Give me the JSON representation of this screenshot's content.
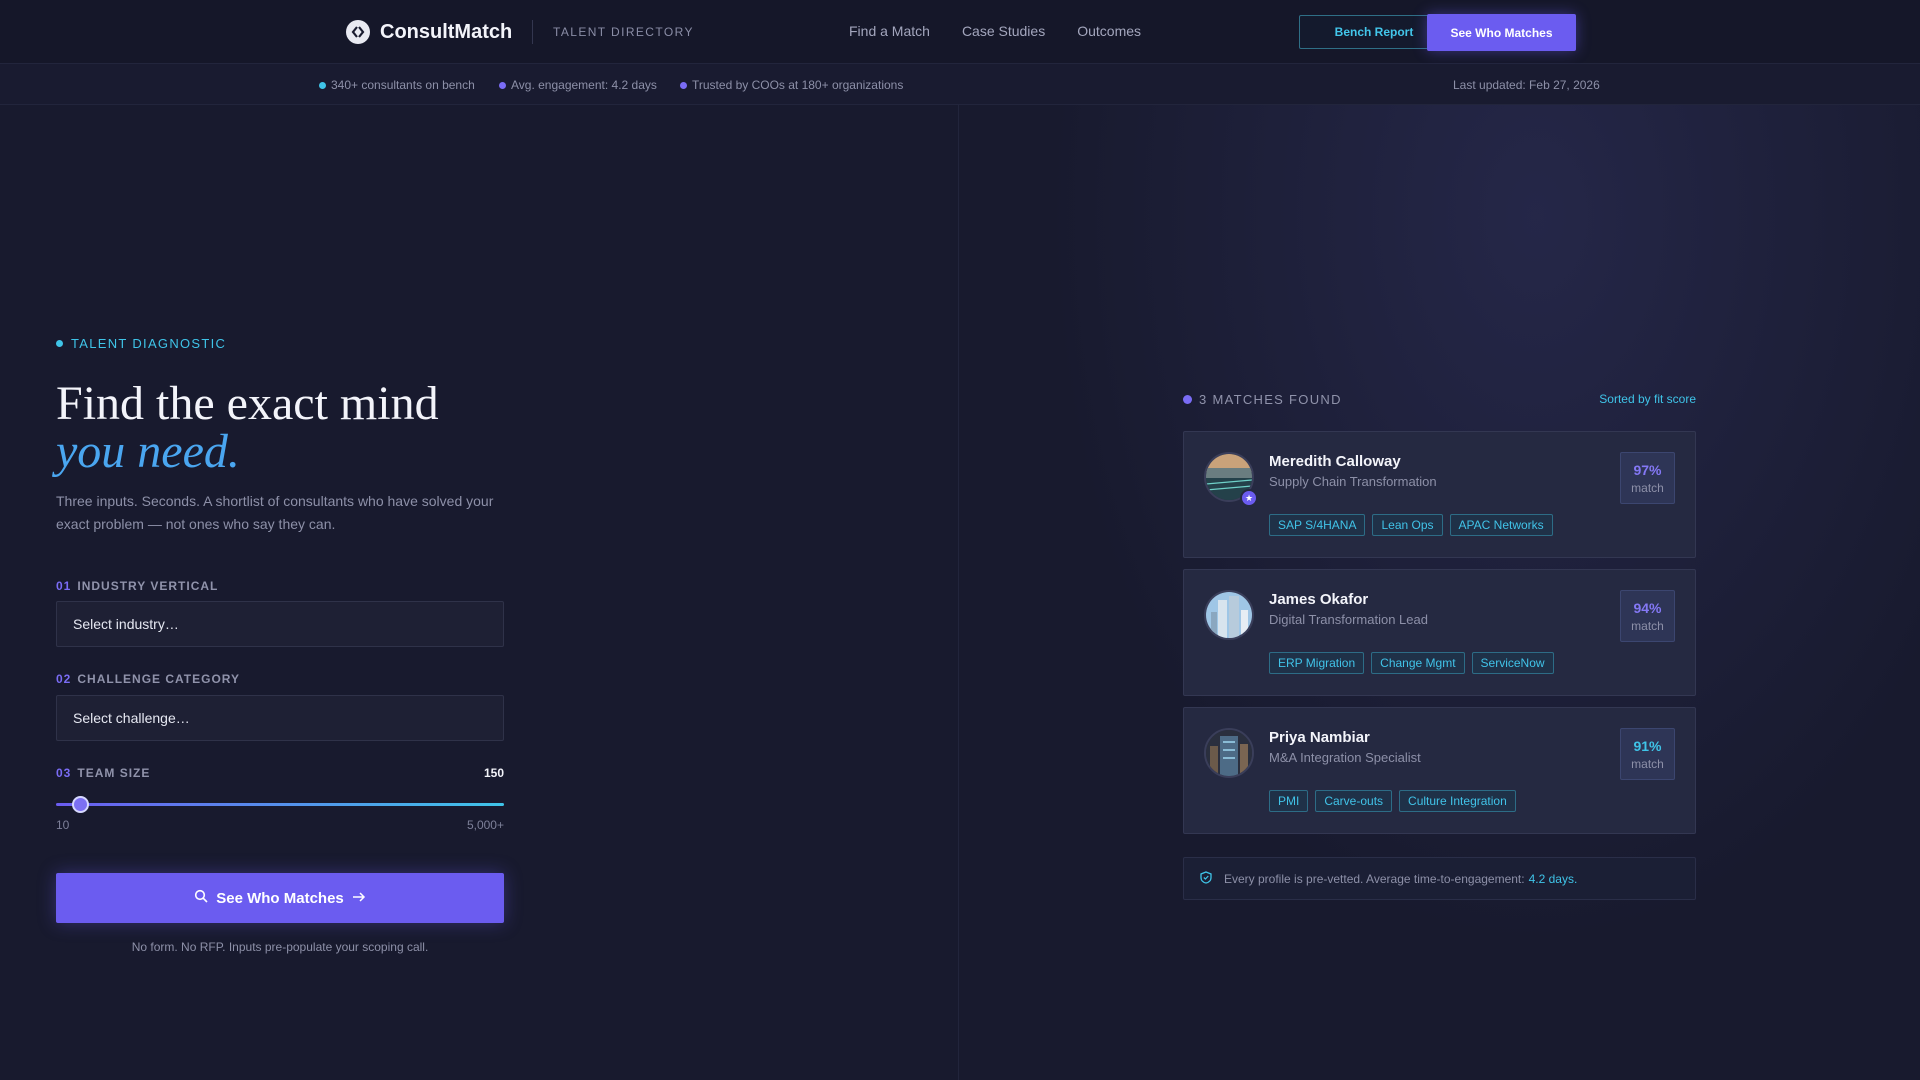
{
  "header": {
    "brand": "ConsultMatch",
    "section": "TALENT DIRECTORY",
    "nav": [
      "Find a Match",
      "Case Studies",
      "Outcomes"
    ],
    "bench_report_label": "Bench Report",
    "see_matches_label": "See Who Matches"
  },
  "stats": [
    {
      "text": "340+ consultants on bench",
      "color": "#3fc4e8"
    },
    {
      "text": "Avg. engagement: 4.2 days",
      "color": "#7a6cf5"
    },
    {
      "text": "Trusted by COOs at 180+ organizations",
      "color": "#7a6cf5"
    }
  ],
  "last_updated": "Last updated: Feb 27, 2026",
  "form": {
    "eyebrow": "TALENT DIAGNOSTIC",
    "title_line1": "Find the exact mind",
    "title_line2": "you need.",
    "subtitle": "Three inputs. Seconds. A shortlist of consultants who have solved your exact problem — not ones who say they can.",
    "industry": {
      "num": "01",
      "label": "INDUSTRY VERTICAL",
      "value": "Select industry…"
    },
    "challenge": {
      "num": "02",
      "label": "CHALLENGE CATEGORY",
      "value": "Select challenge…"
    },
    "team": {
      "num": "03",
      "label": "TEAM SIZE",
      "value": "150",
      "min": "10",
      "max": "5,000+",
      "fraction": 0.028
    },
    "cta_label": "See Who Matches",
    "cta_note": "No form. No RFP. Inputs pre-populate your scoping call."
  },
  "results": {
    "count_label": "3 MATCHES FOUND",
    "sorted_label": "Sorted by fit score",
    "match_word": "match",
    "cards": [
      {
        "name": "Meredith Calloway",
        "role": "Supply Chain Transformation",
        "score": "97%",
        "tags": [
          "SAP S/4HANA",
          "Lean Ops",
          "APAC Networks"
        ]
      },
      {
        "name": "James Okafor",
        "role": "Digital Transformation Lead",
        "score": "94%",
        "tags": [
          "ERP Migration",
          "Change Mgmt",
          "ServiceNow"
        ]
      },
      {
        "name": "Priya Nambiar",
        "role": "M&A Integration Specialist",
        "score": "91%",
        "tags": [
          "PMI",
          "Carve-outs",
          "Culture Integration"
        ]
      }
    ],
    "vetted_text": "Every profile is pre-vetted. Average time-to-engagement:",
    "vetted_highlight": "4.2 days."
  },
  "icons": {
    "logo": "logo-icon",
    "search": "search-icon",
    "arrow": "arrow-right-icon",
    "star": "star-icon",
    "shield": "shield-icon"
  },
  "colors": {
    "accent": "#6b5cf0",
    "cyan": "#3fc4e8",
    "background": "#181a2e"
  }
}
